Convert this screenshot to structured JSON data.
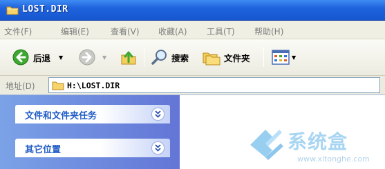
{
  "window": {
    "title": "LOST.DIR"
  },
  "menu": {
    "items": [
      "文件(F)",
      "编辑(E)",
      "查看(V)",
      "收藏(A)",
      "工具(T)",
      "帮助(H)"
    ]
  },
  "toolbar": {
    "back_label": "后退",
    "search_label": "搜索",
    "folders_label": "文件夹"
  },
  "address": {
    "label": "地址(D)",
    "value": "H:\\LOST.DIR"
  },
  "taskpane": {
    "sections": [
      {
        "title": "文件和文件夹任务"
      },
      {
        "title": "其它位置"
      }
    ]
  },
  "watermark": {
    "title": "系统盒",
    "url": "www.xitonghe.com"
  },
  "colors": {
    "titlebar": "#1f63dd",
    "taskpane": "#7ba2e7",
    "section_title": "#215dc6"
  },
  "icons": [
    "folder-icon",
    "back-arrow-icon",
    "forward-arrow-icon",
    "up-folder-icon",
    "search-icon",
    "folders-icon",
    "views-icon",
    "chevron-down-icon"
  ]
}
